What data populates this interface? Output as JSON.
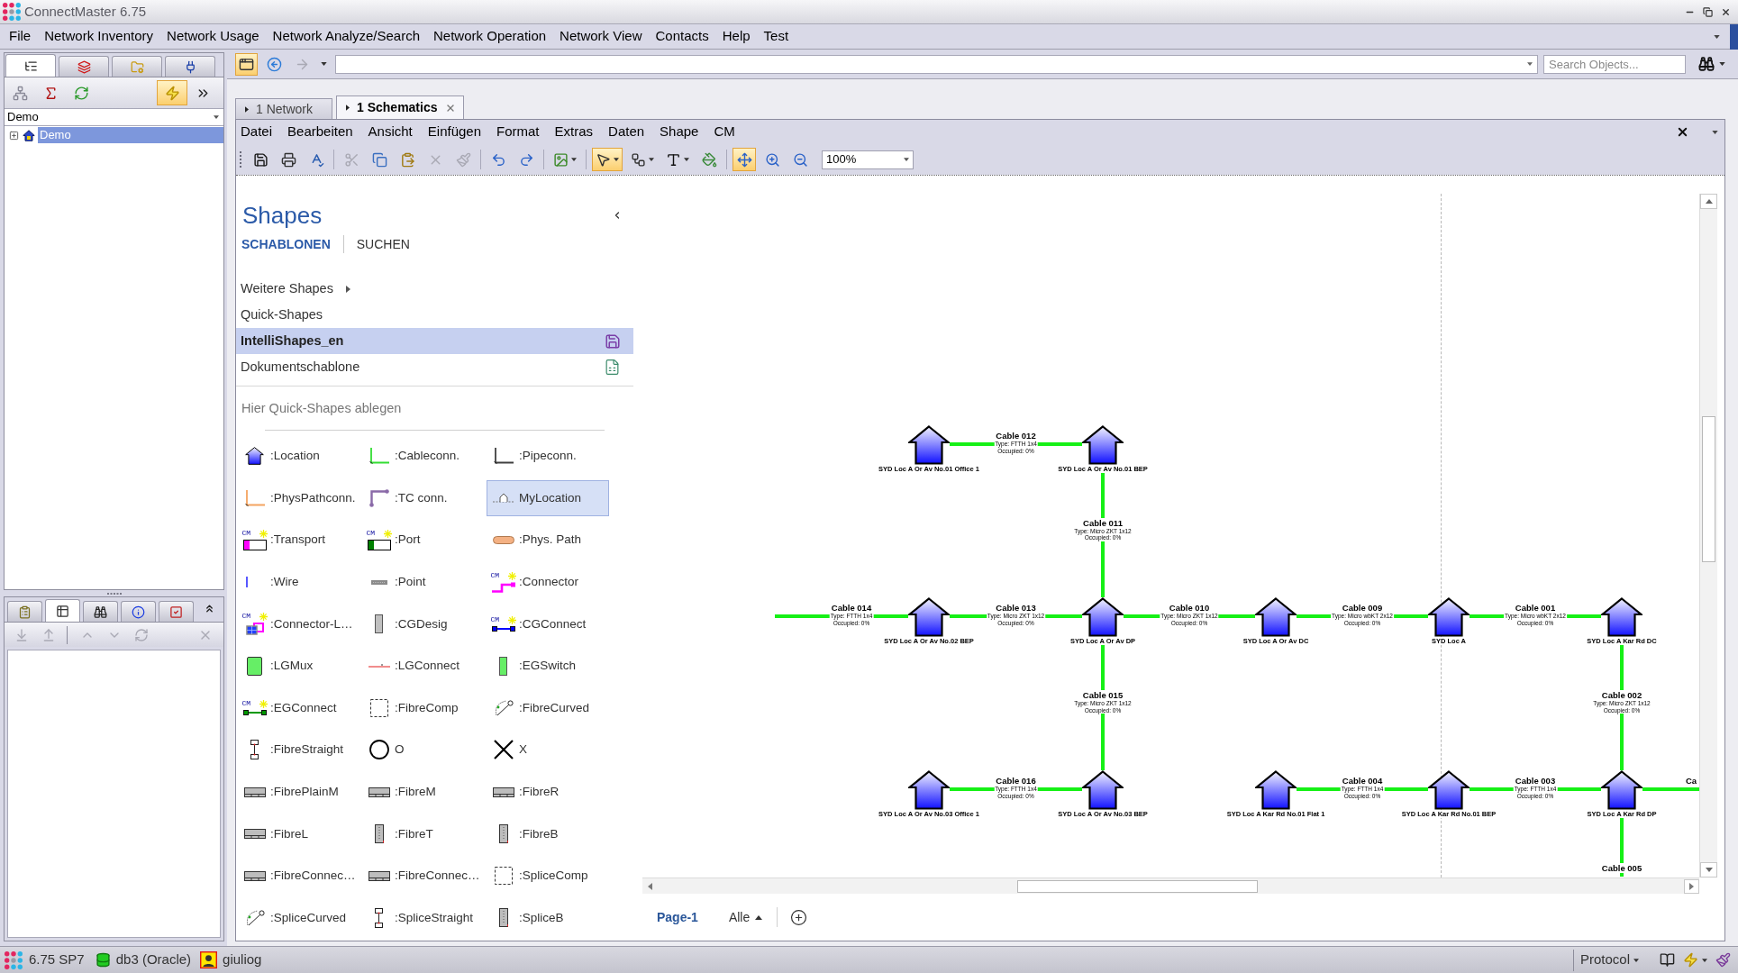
{
  "window": {
    "title": "ConnectMaster 6.75"
  },
  "menu_bar": [
    "File",
    "Network Inventory",
    "Network Usage",
    "Network Analyze/Search",
    "Network Operation",
    "Network View",
    "Contacts",
    "Help",
    "Test"
  ],
  "navigator": {
    "tabs": [
      {
        "kind": "tree",
        "selected": true
      },
      {
        "kind": "layers",
        "selected": false
      },
      {
        "kind": "folder",
        "selected": false
      },
      {
        "kind": "plug",
        "selected": false
      }
    ],
    "tools": [
      {
        "kind": "network",
        "pressed": false
      },
      {
        "kind": "sum",
        "pressed": false
      },
      {
        "kind": "refresh",
        "pressed": false
      },
      {
        "kind": "lightning",
        "pressed": true
      },
      {
        "kind": "more",
        "pressed": false
      }
    ],
    "scope": "Demo",
    "tree": [
      {
        "label": "Demo",
        "selected": true,
        "expanded": false
      }
    ]
  },
  "details": {
    "tabs": [
      {
        "kind": "clipboard",
        "selected": false
      },
      {
        "kind": "table",
        "selected": true
      },
      {
        "kind": "binoculars",
        "selected": false
      },
      {
        "kind": "info",
        "selected": false
      },
      {
        "kind": "checklist",
        "selected": false
      }
    ],
    "tools": [
      [
        {
          "kind": "import",
          "disabled": true
        },
        {
          "kind": "export",
          "disabled": true
        }
      ],
      [
        {
          "kind": "up",
          "disabled": true
        },
        {
          "kind": "down",
          "disabled": true
        },
        {
          "kind": "refresh",
          "disabled": true
        }
      ],
      [
        {
          "kind": "remove",
          "disabled": true
        }
      ]
    ]
  },
  "toolbar": {
    "buttons": [
      {
        "kind": "window",
        "pressed": true,
        "disabled": false
      },
      {
        "kind": "back",
        "pressed": false,
        "disabled": false
      },
      {
        "kind": "forward",
        "pressed": false,
        "disabled": true
      },
      {
        "kind": "history",
        "pressed": false,
        "disabled": false
      }
    ],
    "search": {
      "placeholder": "Search Objects..."
    }
  },
  "document_tabs": [
    {
      "label": "1 Network",
      "selected": false
    },
    {
      "label": "1 Schematics",
      "selected": true
    }
  ],
  "editor": {
    "menu": [
      "Datei",
      "Bearbeiten",
      "Ansicht",
      "Einfügen",
      "Format",
      "Extras",
      "Daten",
      "Shape",
      "CM"
    ],
    "toolbar": [
      [
        {
          "kind": "save",
          "pressed": false,
          "disabled": false,
          "dropdown": false
        },
        {
          "kind": "print",
          "pressed": false,
          "disabled": false,
          "dropdown": false
        },
        {
          "kind": "spell",
          "pressed": false,
          "disabled": false,
          "dropdown": false
        }
      ],
      [
        {
          "kind": "cut",
          "pressed": false,
          "disabled": true,
          "dropdown": false
        },
        {
          "kind": "copy",
          "pressed": false,
          "disabled": false,
          "dropdown": false
        },
        {
          "kind": "paste",
          "pressed": false,
          "disabled": false,
          "dropdown": false
        },
        {
          "kind": "delete",
          "pressed": false,
          "disabled": true,
          "dropdown": false
        },
        {
          "kind": "brush",
          "pressed": false,
          "disabled": true,
          "dropdown": false
        }
      ],
      [
        {
          "kind": "undo",
          "pressed": false,
          "disabled": false,
          "dropdown": false
        },
        {
          "kind": "redo",
          "pressed": false,
          "disabled": false,
          "dropdown": false
        }
      ],
      [
        {
          "kind": "picture",
          "pressed": false,
          "disabled": false,
          "dropdown": true
        }
      ],
      [
        {
          "kind": "pointer",
          "pressed": true,
          "disabled": false,
          "dropdown": true
        },
        {
          "kind": "connector",
          "pressed": false,
          "disabled": false,
          "dropdown": true
        },
        {
          "kind": "text",
          "pressed": false,
          "disabled": false,
          "dropdown": true
        },
        {
          "kind": "fill",
          "pressed": false,
          "disabled": false,
          "dropdown": false
        }
      ],
      [
        {
          "kind": "pan",
          "pressed": true,
          "disabled": false,
          "dropdown": false
        },
        {
          "kind": "zoom-in",
          "pressed": false,
          "disabled": false,
          "dropdown": false
        },
        {
          "kind": "zoom-out",
          "pressed": false,
          "disabled": false,
          "dropdown": false
        }
      ]
    ],
    "zoom": "100%",
    "shapes": {
      "title": "Shapes",
      "tabs": [
        {
          "label": "SCHABLONEN",
          "selected": true
        },
        {
          "label": "SUCHEN",
          "selected": false
        }
      ],
      "stencils": [
        {
          "label": "Weitere Shapes",
          "kind": "submenu",
          "selected": false
        },
        {
          "label": "Quick-Shapes",
          "kind": "plain",
          "selected": false
        },
        {
          "label": "IntelliShapes_en",
          "kind": "saved",
          "selected": true
        },
        {
          "label": "Dokumentschablone",
          "kind": "document",
          "selected": false
        }
      ],
      "drop_hint": "Hier Quick-Shapes ablegen",
      "items": [
        {
          "label": ":Location",
          "kind": "house",
          "selected": false
        },
        {
          "label": ":Cableconn.",
          "kind": "corner",
          "color": "#33dd33",
          "selected": false
        },
        {
          "label": ":Pipeconn.",
          "kind": "corner",
          "color": "#404040",
          "selected": false
        },
        {
          "label": ":PhysPathconn.",
          "kind": "corner",
          "color": "#f4a460",
          "selected": false
        },
        {
          "label": ":TC conn.",
          "kind": "elbow",
          "color": "#8a6aa8",
          "selected": false
        },
        {
          "label": "MyLocation",
          "kind": "marker",
          "selected": true
        },
        {
          "label": ":Transport",
          "kind": "bar",
          "color": "#ff00ff",
          "badge": "CM",
          "selected": false
        },
        {
          "label": ":Port",
          "kind": "bar",
          "color": "#008000",
          "badge": "CM",
          "selected": false
        },
        {
          "label": ":Phys. Path",
          "kind": "pill",
          "selected": false
        },
        {
          "label": ":Wire",
          "kind": "wire",
          "selected": false
        },
        {
          "label": ":Point",
          "kind": "point",
          "selected": false
        },
        {
          "label": ":Connector",
          "kind": "step",
          "badge": "CM",
          "selected": false
        },
        {
          "label": ":Connector-L…",
          "kind": "node",
          "badge": "CM",
          "selected": false
        },
        {
          "label": ":CGDesig",
          "kind": "column",
          "color": "#c0c0c0",
          "selected": false
        },
        {
          "label": ":CGConnect",
          "kind": "link",
          "color": "#0000ff",
          "badge": "CM",
          "selected": false
        },
        {
          "label": ":LGMux",
          "kind": "block",
          "selected": false
        },
        {
          "label": ":LGConnect",
          "kind": "line",
          "selected": false
        },
        {
          "label": ":EGSwitch",
          "kind": "column",
          "color": "#66ee66",
          "selected": false
        },
        {
          "label": ":EGConnect",
          "kind": "link",
          "color": "#009900",
          "badge": "CM",
          "selected": false
        },
        {
          "label": ":FibreComp",
          "kind": "frame",
          "selected": false
        },
        {
          "label": ":FibreCurved",
          "kind": "curve",
          "selected": false
        },
        {
          "label": ":FibreStraight",
          "kind": "straight",
          "selected": false
        },
        {
          "label": "O",
          "kind": "circle",
          "selected": false
        },
        {
          "label": "X",
          "kind": "cross",
          "selected": false
        },
        {
          "label": ":FibrePlainM",
          "kind": "tray",
          "selected": false
        },
        {
          "label": ":FibreM",
          "kind": "tray",
          "selected": false
        },
        {
          "label": ":FibreR",
          "kind": "tray",
          "selected": false
        },
        {
          "label": ":FibreL",
          "kind": "tray",
          "selected": false
        },
        {
          "label": ":FibreT",
          "kind": "rack",
          "selected": false
        },
        {
          "label": ":FibreB",
          "kind": "rack",
          "selected": false
        },
        {
          "label": ":FibreConnec…",
          "kind": "tray",
          "selected": false
        },
        {
          "label": ":FibreConnec…",
          "kind": "tray",
          "selected": false
        },
        {
          "label": ":SpliceComp",
          "kind": "frame",
          "selected": false
        },
        {
          "label": ":SpliceCurved",
          "kind": "curve",
          "selected": false
        },
        {
          "label": ":SpliceStraight",
          "kind": "straight",
          "selected": false
        },
        {
          "label": ":SpliceB",
          "kind": "rack",
          "selected": false
        }
      ]
    },
    "diagram": {
      "nodes": [
        "SYD Loc A Or Av No.01 Office 1",
        "SYD Loc A Or Av No.01 BEP",
        "SYD Loc A Or Av No.02 BEP",
        "SYD Loc A Or Av DP",
        "SYD Loc A Or Av DC",
        "SYD Loc A",
        "SYD Loc A Kar Rd DC",
        "SYD Loc A Or Av No.03 Office 1",
        "SYD Loc A Or Av No.03 BEP",
        "SYD Loc A Kar Rd No.01 Flat 1",
        "SYD Loc A Kar Rd No.01 BEP",
        "SYD Loc A Kar Rd DP"
      ],
      "cables": [
        {
          "name": "Cable 012",
          "type": "Type: FTTH 1x4",
          "occupied": "Occupied: 0%"
        },
        {
          "name": "Cable 011",
          "type": "Type: Micro ZKT 1x12",
          "occupied": "Occupied: 0%"
        },
        {
          "name": "Cable 014",
          "type": "Type: FTTH 1x4",
          "occupied": "Occupied: 0%"
        },
        {
          "name": "Cable 013",
          "type": "Type: Micro ZKT 1x12",
          "occupied": "Occupied: 0%"
        },
        {
          "name": "Cable 010",
          "type": "Type: Micro ZKT 1x12",
          "occupied": "Occupied: 0%"
        },
        {
          "name": "Cable 009",
          "type": "Type: Micro wbKT 2x12",
          "occupied": "Occupied: 0%"
        },
        {
          "name": "Cable 001",
          "type": "Type: Micro wbKT 2x12",
          "occupied": "Occupied: 0%"
        },
        {
          "name": "Cable 015",
          "type": "Type: Micro ZKT 1x12",
          "occupied": "Occupied: 0%"
        },
        {
          "name": "Cable 002",
          "type": "Type: Micro ZKT 1x12",
          "occupied": "Occupied: 0%"
        },
        {
          "name": "Cable 016",
          "type": "Type: FTTH 1x4",
          "occupied": "Occupied: 0%"
        },
        {
          "name": "Cable 004",
          "type": "Type: FTTH 1x4",
          "occupied": "Occupied: 0%"
        },
        {
          "name": "Cable 003",
          "type": "Type: FTTH 1x4",
          "occupied": "Occupied: 0%"
        },
        {
          "name": "Ca"
        },
        {
          "name": "Cable 005"
        }
      ]
    },
    "pages": [
      {
        "label": "Page-1",
        "selected": true
      }
    ],
    "page_filter": "Alle"
  },
  "status_bar": {
    "version": "6.75 SP7",
    "database": "db3 (Oracle)",
    "user": "giuliog",
    "protocol": "Protocol"
  }
}
